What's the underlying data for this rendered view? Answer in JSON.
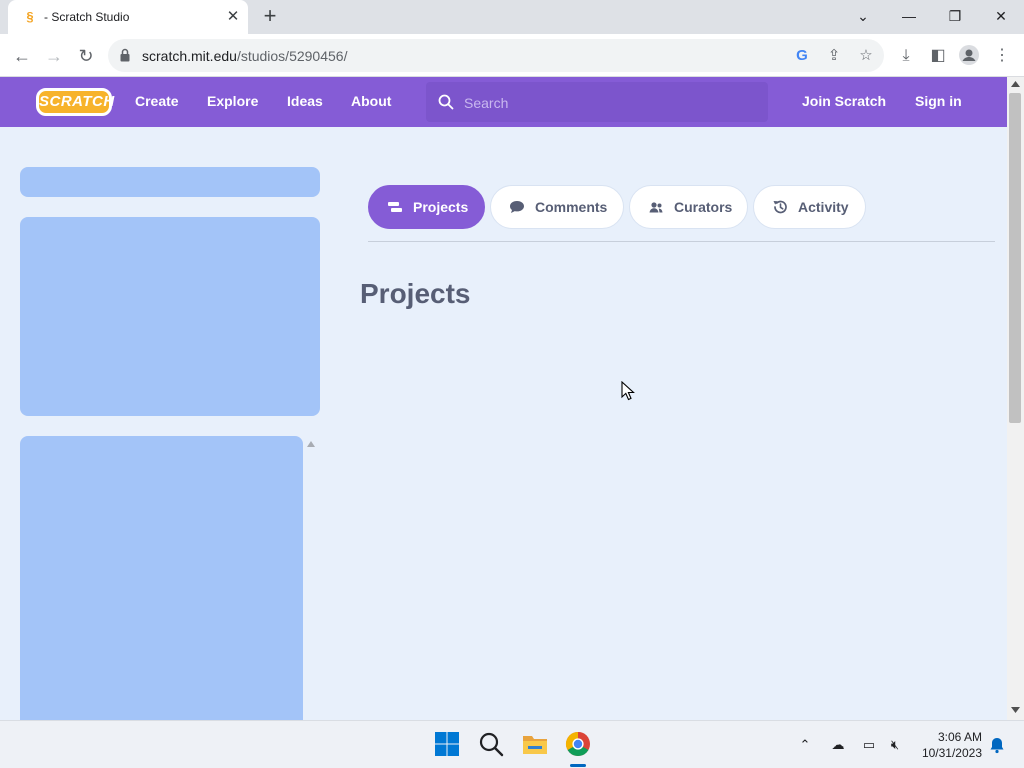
{
  "browser": {
    "tab_title": "- Scratch Studio",
    "tab_favicon": "§",
    "url_host": "scratch.mit.edu",
    "url_path": "/studios/5290456/",
    "icons": [
      "back-icon",
      "forward-icon",
      "reload-icon",
      "lock-icon",
      "google-icon",
      "share-icon",
      "star-icon",
      "download-icon",
      "sidepanel-icon",
      "profile-icon",
      "menu-icon"
    ]
  },
  "scratch_nav": {
    "logo": "SCRATCH",
    "links": {
      "create": "Create",
      "explore": "Explore",
      "ideas": "Ideas",
      "about": "About"
    },
    "search_placeholder": "Search",
    "join": "Join Scratch",
    "signin": "Sign in",
    "color": "#855cd6"
  },
  "studio": {
    "tabs": {
      "projects": "Projects",
      "comments": "Comments",
      "curators": "Curators",
      "activity": "Activity"
    },
    "active_tab": "Projects",
    "section_title": "Projects"
  },
  "taskbar": {
    "time": "3:06 AM",
    "date": "10/31/2023",
    "apps": [
      "windows-start-icon",
      "search-icon",
      "file-explorer-icon",
      "chrome-icon"
    ]
  }
}
